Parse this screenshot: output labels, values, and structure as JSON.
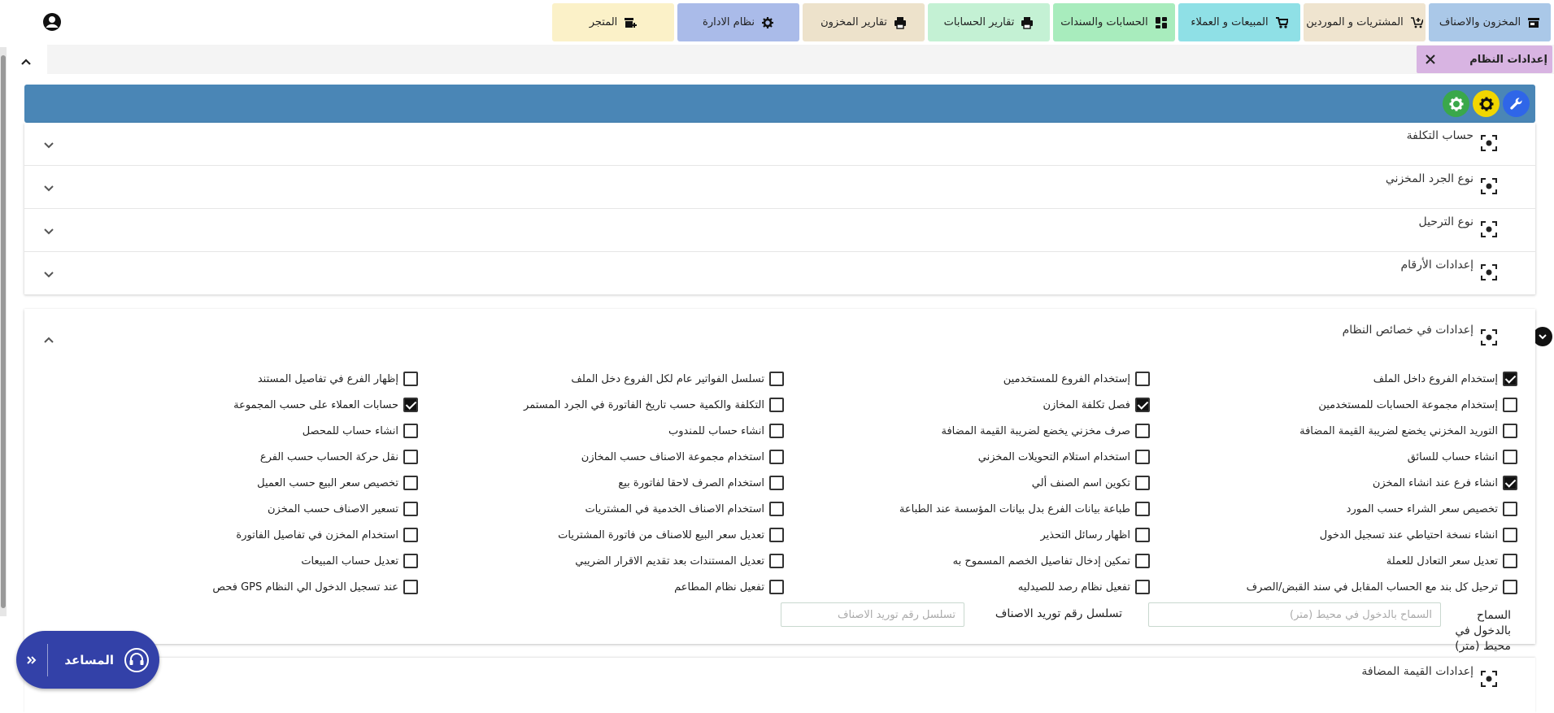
{
  "nav": {
    "tabs": [
      {
        "label": "المخزون والاصناف",
        "color": "#aac8e8",
        "icon": "store-icon"
      },
      {
        "label": "المشتريات و الموردين",
        "color": "#efe4cf",
        "icon": "cart-add-icon"
      },
      {
        "label": "المبيعات و العملاء",
        "color": "#8fe0e6",
        "icon": "cart-icon"
      },
      {
        "label": "الحسابات والسندات",
        "color": "#a8ecbd",
        "icon": "accounts-icon"
      },
      {
        "label": "تقارير الحسابات",
        "color": "#c4f1d4",
        "icon": "printer-icon"
      },
      {
        "label": "تقارير المخزون",
        "color": "#ede2cb",
        "icon": "printer-icon"
      },
      {
        "label": "نظام الادارة",
        "color": "#aabbe9",
        "icon": "gear-icon"
      },
      {
        "label": "المتجر",
        "color": "#fbf1c8",
        "icon": "store-add-icon"
      }
    ]
  },
  "breadcrumb": {
    "label": "إعدادات النظام"
  },
  "sections": [
    {
      "title": "حساب التكلفة"
    },
    {
      "title": "نوع الجرد المخزني"
    },
    {
      "title": "نوع الترحيل"
    },
    {
      "title": "إعدادات الأرقام"
    }
  ],
  "system": {
    "title": "إعدادات في خصائص النظام",
    "col1": [
      {
        "label": "إستخدام الفروع داخل الملف",
        "checked": true
      },
      {
        "label": "إستخدام مجموعة الحسابات للمستخدمين",
        "checked": false
      },
      {
        "label": "التوريد المخزني يخضع لضريبة القيمة المضافة",
        "checked": false
      },
      {
        "label": "انشاء حساب للسائق",
        "checked": false
      },
      {
        "label": "انشاء فرع عند انشاء المخزن",
        "checked": true
      },
      {
        "label": "تخصيص سعر الشراء حسب المورد",
        "checked": false
      },
      {
        "label": "انشاء نسخة احتياطي عند تسجيل الدخول",
        "checked": false
      },
      {
        "label": "تعديل سعر التعادل للعملة",
        "checked": false
      },
      {
        "label": "ترحيل كل بند مع الحساب المقابل في سند القبض/الصرف",
        "checked": false
      }
    ],
    "col2": [
      {
        "label": "إستخدام الفروع للمستخدمين",
        "checked": false
      },
      {
        "label": "فصل تكلفة المخازن",
        "checked": true
      },
      {
        "label": "صرف مخزني يخضع لضريبة القيمة المضافة",
        "checked": false
      },
      {
        "label": "استخدام استلام التحويلات المخزني",
        "checked": false
      },
      {
        "label": "تكوين اسم الصنف ألي",
        "checked": false
      },
      {
        "label": "طباعة بيانات الفرع بدل بيانات المؤسسة عند الطباعة",
        "checked": false
      },
      {
        "label": "اظهار رسائل التحذير",
        "checked": false
      },
      {
        "label": "تمكين إدخال تفاصيل الخصم المسموح به",
        "checked": false
      },
      {
        "label": "تفعيل نظام رصد للصيدليه",
        "checked": false
      }
    ],
    "col3": [
      {
        "label": "تسلسل الفواتير عام لكل الفروع دخل الملف",
        "checked": false
      },
      {
        "label": "التكلفة والكمية حسب تاريخ الفاتورة في الجرد المستمر",
        "checked": false
      },
      {
        "label": "انشاء حساب للمندوب",
        "checked": false
      },
      {
        "label": "استخدام مجموعة الاصناف حسب المخازن",
        "checked": false
      },
      {
        "label": "استخدام الصرف لاحقا لفاتورة بيع",
        "checked": false
      },
      {
        "label": "استخدام الاصناف الخدمية في المشتريات",
        "checked": false
      },
      {
        "label": "تعديل سعر البيع للاصناف من فاتورة المشتريات",
        "checked": false
      },
      {
        "label": "تعديل المستندات بعد تقديم الاقرار الضريبي",
        "checked": false
      },
      {
        "label": "تفعيل نظام المطاعم",
        "checked": false
      }
    ],
    "col4": [
      {
        "label": "إظهار الفرع في تفاصيل المستند",
        "checked": false
      },
      {
        "label": "حسابات العملاء على حسب المجموعة",
        "checked": true
      },
      {
        "label": "انشاء حساب للمحصل",
        "checked": false
      },
      {
        "label": "نقل حركة الحساب حسب الفرع",
        "checked": false
      },
      {
        "label": "تخصيص سعر البيع حسب العميل",
        "checked": false
      },
      {
        "label": "تسعير الاصناف حسب المخزن",
        "checked": false
      },
      {
        "label": "استخدام المخزن في تفاصيل الفاتورة",
        "checked": false
      },
      {
        "label": "تعديل حساب المبيعات",
        "checked": false
      },
      {
        "label": "فحص GPS عند تسجيل الدخول الي النظام",
        "checked": false
      }
    ],
    "geo_label_line1": "السماح",
    "geo_label_line2": "بالدخول في",
    "geo_label_line3": "محيط (متر)",
    "geo_placeholder": "السماح بالدخول في محيط (متر)",
    "seq_label": "تسلسل رقم توريد الاصناف",
    "seq_placeholder": "تسلسل رقم توريد الاصناف"
  },
  "vat": {
    "title": "إعدادات القيمة المضافة"
  },
  "assistant": {
    "label": "المساعد"
  }
}
